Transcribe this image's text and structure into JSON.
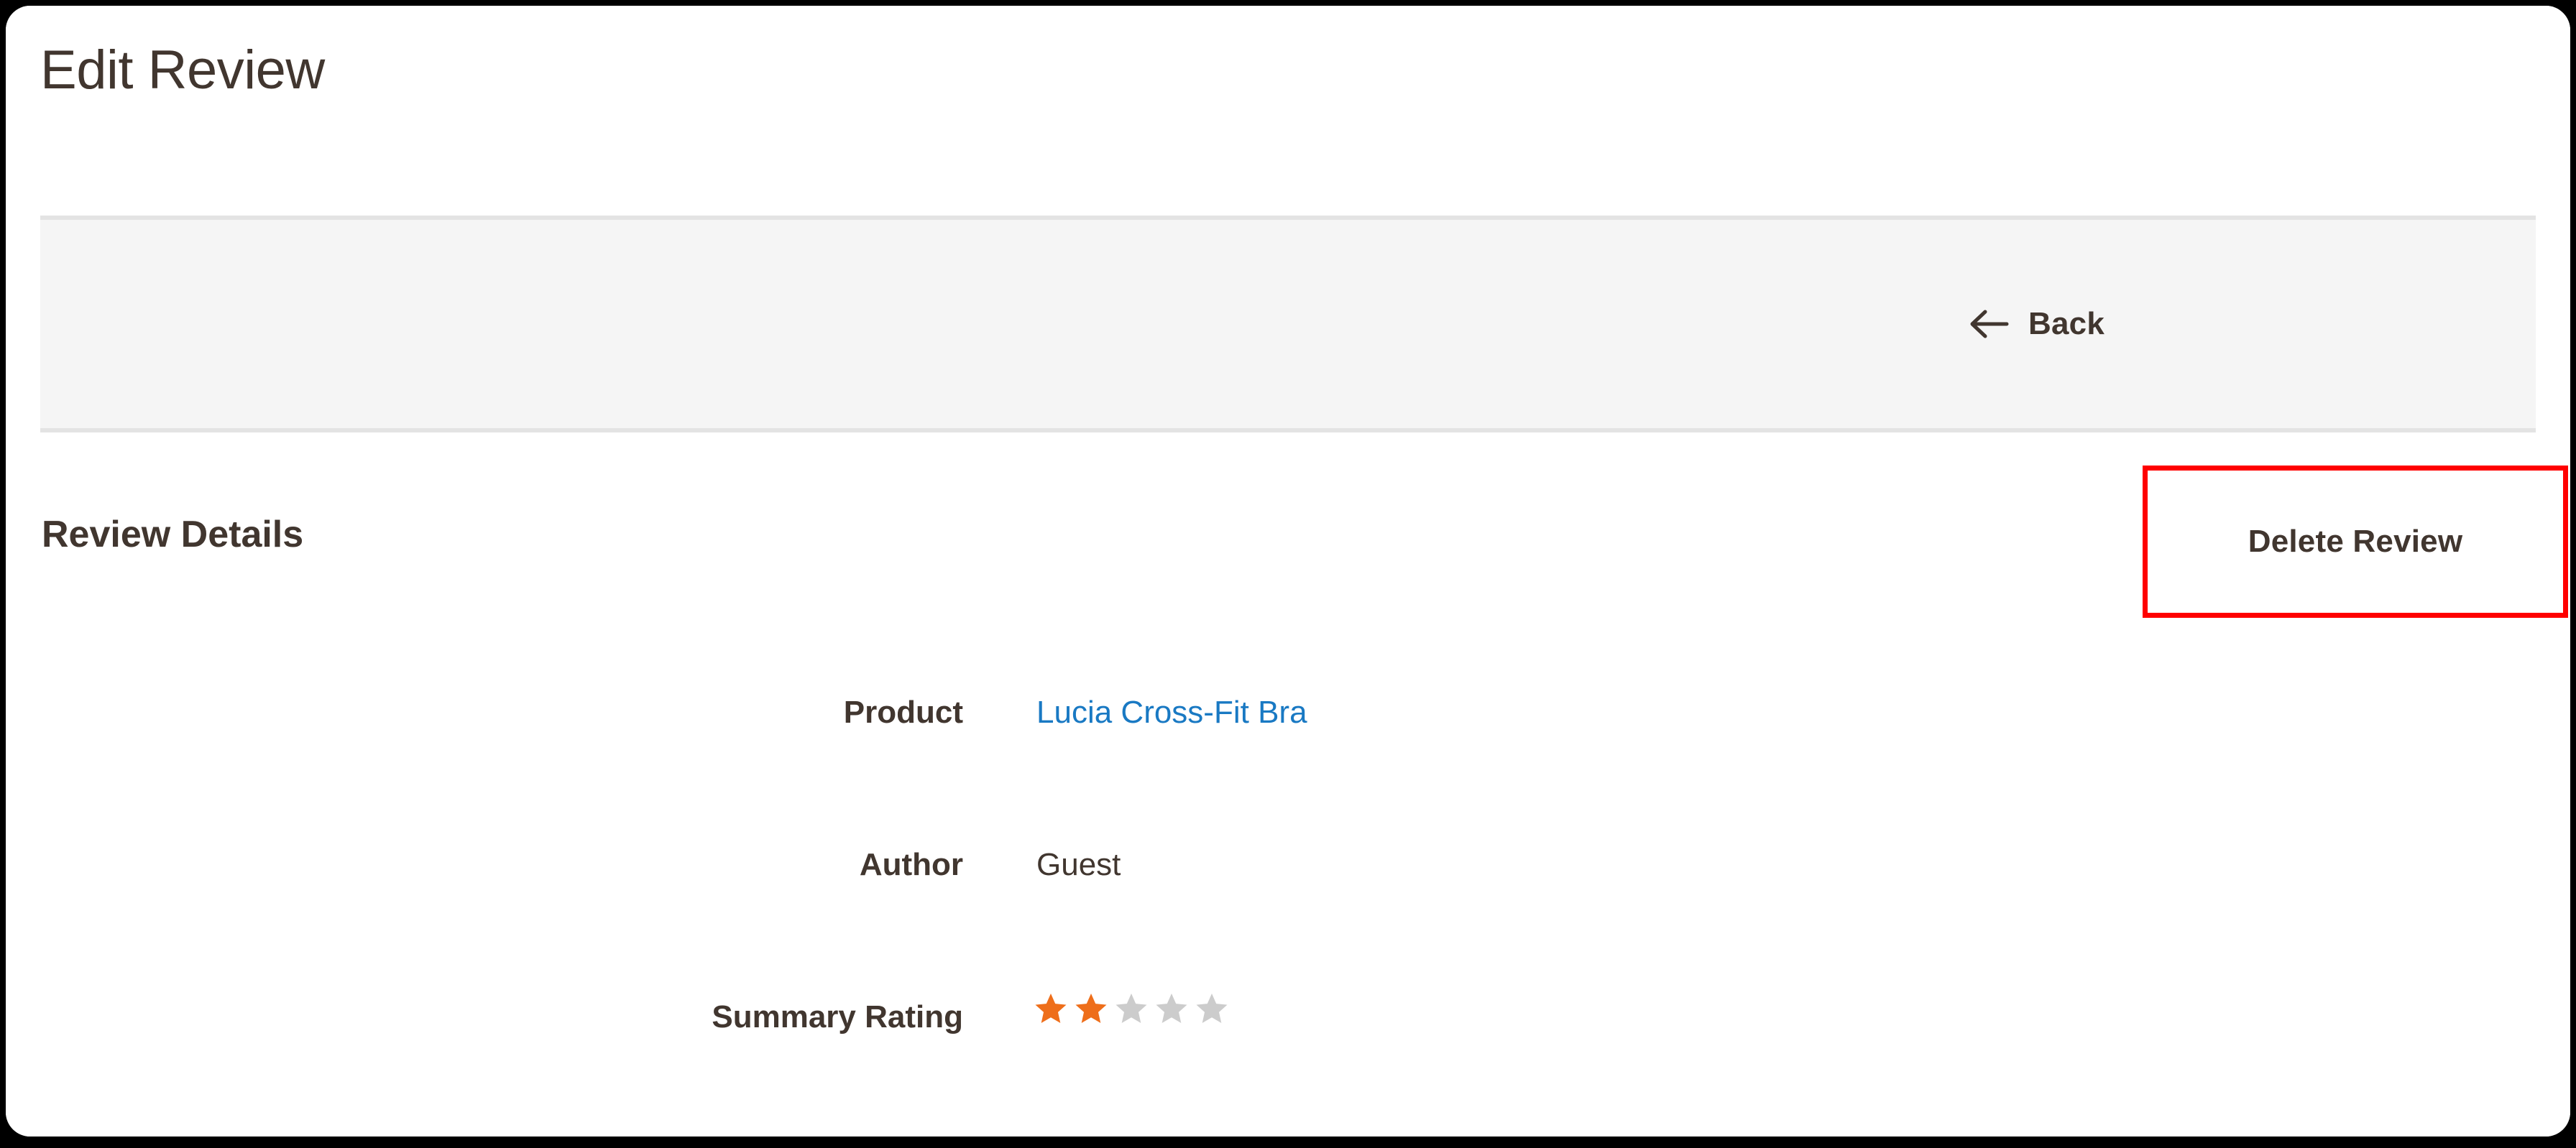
{
  "page": {
    "title": "Edit Review"
  },
  "toolbar": {
    "back_label": "Back",
    "back_icon": "arrow-left-icon",
    "delete_label": "Delete Review",
    "highlight_color": "#ff0000"
  },
  "review_details": {
    "section_heading": "Review Details",
    "fields": [
      {
        "label": "Product",
        "value": "Lucia Cross-Fit Bra",
        "type": "link"
      },
      {
        "label": "Author",
        "value": "Guest",
        "type": "text"
      },
      {
        "label": "Summary Rating",
        "value": "",
        "type": "rating"
      }
    ]
  },
  "rating": {
    "label": "Summary Rating",
    "filled": 2,
    "total": 5,
    "filled_color": "#ee6e1a",
    "empty_color": "#cccccc"
  },
  "colors": {
    "link": "#1979c3",
    "text": "#41362f",
    "toolbar_bg": "#f5f5f5",
    "toolbar_border": "#e3e3e3",
    "accent_orange": "#ee6e1a",
    "highlight_red": "#ff0000"
  }
}
